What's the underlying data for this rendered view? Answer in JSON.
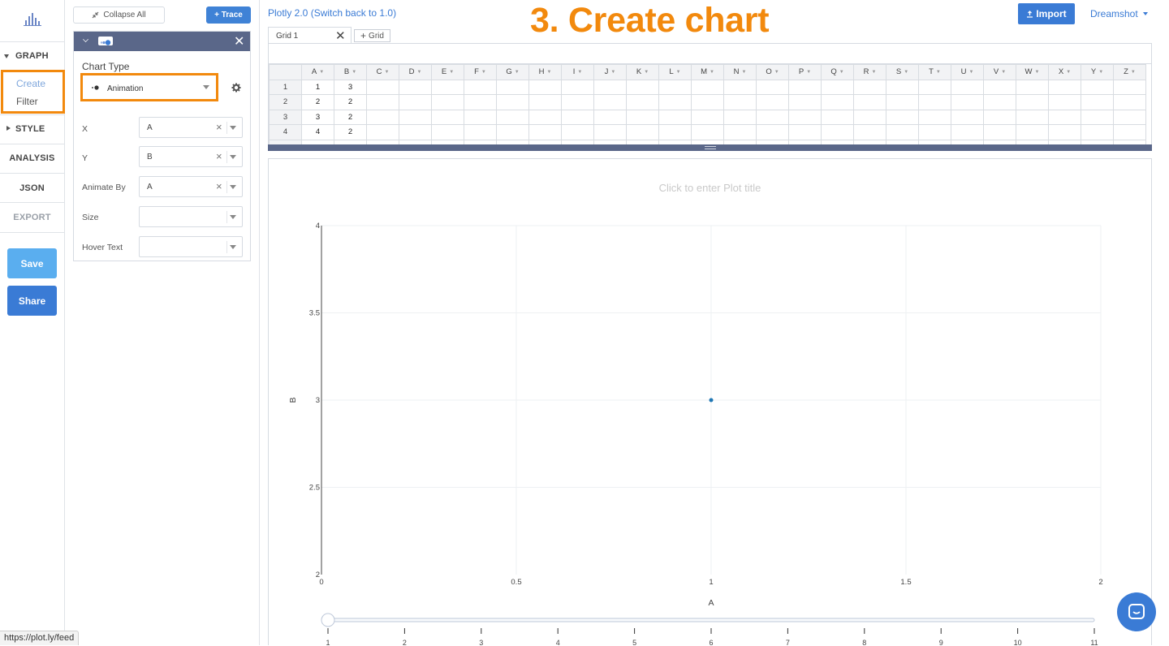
{
  "app": {
    "switch_link": "Plotly 2.0 (Switch back to 1.0)",
    "step_title": "3. Create chart",
    "import_label": "Import",
    "user_menu": "Dreamshot",
    "status_url": "https://plot.ly/feed"
  },
  "colors": {
    "accent": "#3a7bd5",
    "highlight": "#f2890d",
    "panel_header": "#5a6789",
    "save_button": "#5aaeef",
    "share_button": "#3a7bd5"
  },
  "leftnav": {
    "logo_icon": "plotly-logo-icon",
    "sections": [
      "GRAPH",
      "STYLE",
      "ANALYSIS",
      "JSON",
      "EXPORT"
    ],
    "graph_items": [
      "Create",
      "Filter"
    ],
    "save_label": "Save",
    "share_label": "Share"
  },
  "panel": {
    "collapse_label": "Collapse All",
    "add_trace_label": "+ Trace",
    "chart_type_label": "Chart Type",
    "chart_type_value": "Animation",
    "fields": [
      {
        "label": "X",
        "value": "A"
      },
      {
        "label": "Y",
        "value": "B"
      },
      {
        "label": "Animate By",
        "value": "A"
      },
      {
        "label": "Size",
        "value": ""
      },
      {
        "label": "Hover Text",
        "value": ""
      }
    ]
  },
  "grid": {
    "tab_label": "Grid 1",
    "add_grid_label": "Grid",
    "columns": [
      "A",
      "B",
      "C",
      "D",
      "E",
      "F",
      "G",
      "H",
      "I",
      "J",
      "K",
      "L",
      "M",
      "N",
      "O",
      "P",
      "Q",
      "R",
      "S",
      "T",
      "U",
      "V",
      "W",
      "X",
      "Y",
      "Z"
    ],
    "rows": [
      {
        "num": "1",
        "A": "1",
        "B": "3"
      },
      {
        "num": "2",
        "A": "2",
        "B": "2"
      },
      {
        "num": "3",
        "A": "3",
        "B": "2"
      },
      {
        "num": "4",
        "A": "4",
        "B": "2"
      }
    ]
  },
  "plot": {
    "title_placeholder": "Click to enter Plot title",
    "slider_ticks": [
      "1",
      "2",
      "3",
      "4",
      "5",
      "6",
      "7",
      "8",
      "9",
      "10",
      "11"
    ],
    "slider_value": 1
  },
  "chart_data": {
    "type": "scatter",
    "title": "",
    "xlabel": "A",
    "ylabel": "B",
    "xlim": [
      0,
      2
    ],
    "ylim": [
      2,
      4
    ],
    "xticks": [
      "0",
      "0.5",
      "1",
      "1.5",
      "2"
    ],
    "yticks": [
      "2",
      "2.5",
      "3",
      "3.5",
      "4"
    ],
    "grid": true,
    "points": [
      {
        "x": 1,
        "y": 3
      }
    ]
  }
}
